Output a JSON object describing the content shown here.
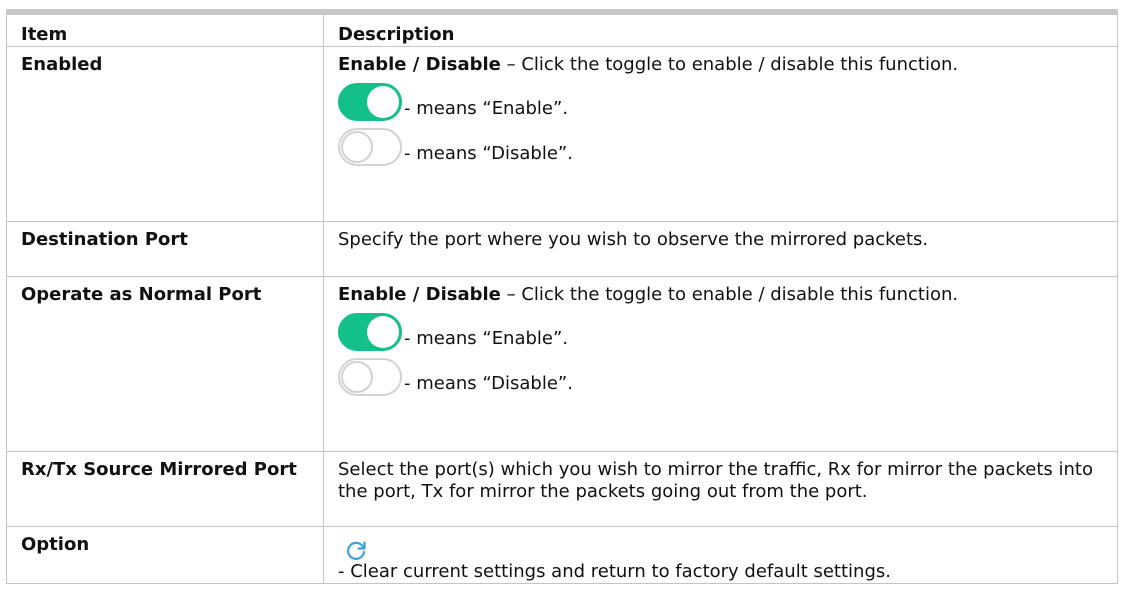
{
  "table": {
    "headers": {
      "item": "Item",
      "description": "Description"
    },
    "enabled": {
      "item": "Enabled",
      "bold_label": "Enable / Disable",
      "text": " – Click the toggle to enable / disable this function.",
      "on_caption": "- means “Enable”.",
      "off_caption": "- means “Disable”."
    },
    "destination_port": {
      "item": "Destination Port",
      "text": "Specify the port where you wish to observe the mirrored packets."
    },
    "operate_normal": {
      "item": "Operate as Normal Port",
      "bold_label": "Enable / Disable",
      "text": " – Click the toggle to enable / disable this function.",
      "on_caption": "- means “Enable”.",
      "off_caption": "- means “Disable”."
    },
    "rxtx_source": {
      "item": "Rx/Tx Source Mirrored Port",
      "text": "Select the port(s) which you wish to mirror the traffic, Rx for mirror the packets into the port, Tx for mirror the packets going out from the port."
    },
    "option": {
      "item": "Option",
      "text": "- Clear current settings and return to factory default settings."
    }
  },
  "colors": {
    "toggle_on": "#14c08a",
    "toggle_off_border": "#d2d2d2",
    "refresh_icon": "#3aa0e0",
    "border": "#c4c4c4"
  },
  "icons": {
    "toggle_on": "toggle-on-icon",
    "toggle_off": "toggle-off-icon",
    "refresh": "refresh-icon"
  }
}
